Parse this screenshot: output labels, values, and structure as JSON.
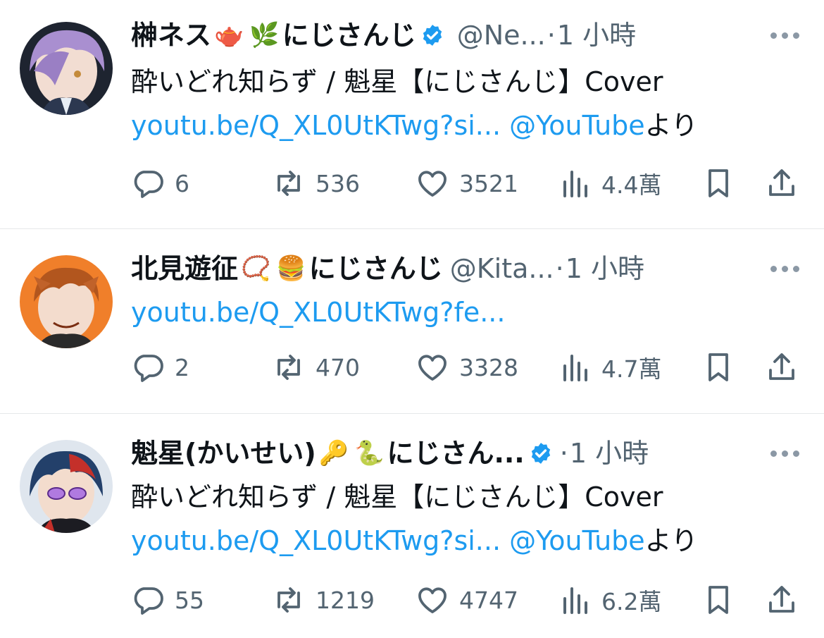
{
  "colors": {
    "accent": "#1d9bf0",
    "muted": "#536471",
    "text": "#0f1419",
    "verified": "#1d9bf0"
  },
  "tweets": [
    {
      "name": "榊ネス",
      "emojis": [
        "🫖",
        "🌿"
      ],
      "name_suffix": "にじさんじ",
      "verified": true,
      "handle": "@Ne...",
      "time_sep": "·",
      "time": "1 小時",
      "text": "酔いどれ知らず / 魁星【にじさんじ】Cover",
      "link": "youtu.be/Q_XL0UtKTwg?si...",
      "mention": "@YouTube",
      "mention_suffix": "より",
      "stats": {
        "replies": "6",
        "retweets": "536",
        "likes": "3521",
        "views": "4.4萬"
      }
    },
    {
      "name": "北見遊征",
      "emojis": [
        "📿",
        "🍔"
      ],
      "name_suffix": "にじさんじ",
      "verified": false,
      "handle": "@Kita...",
      "time_sep": "·",
      "time": "1 小時",
      "text": "",
      "link": "youtu.be/Q_XL0UtKTwg?fe...",
      "mention": "",
      "mention_suffix": "",
      "stats": {
        "replies": "2",
        "retweets": "470",
        "likes": "3328",
        "views": "4.7萬"
      }
    },
    {
      "name": "魁星(かいせい)",
      "emojis": [
        "🔑",
        "🐍"
      ],
      "name_suffix": "にじさん...",
      "verified": true,
      "handle": "",
      "time_sep": "·",
      "time": "1 小時",
      "text": "酔いどれ知らず / 魁星【にじさんじ】Cover",
      "link": "youtu.be/Q_XL0UtKTwg?si...",
      "mention": "@YouTube",
      "mention_suffix": "より",
      "stats": {
        "replies": "55",
        "retweets": "1219",
        "likes": "4747",
        "views": "6.2萬"
      }
    }
  ]
}
